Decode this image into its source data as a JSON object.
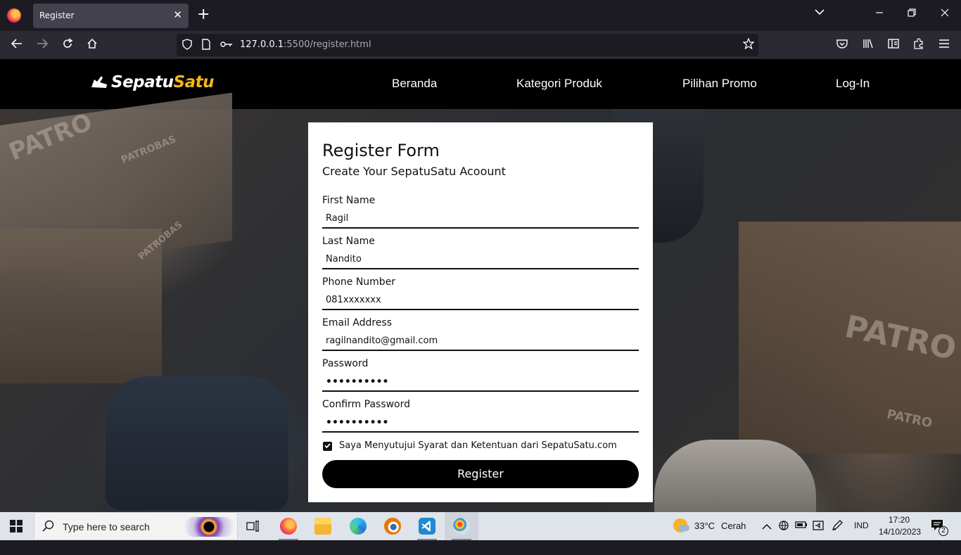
{
  "browser": {
    "tab_title": "Register",
    "tab_close": "✕",
    "new_tab": "+",
    "tab_list": "⌄",
    "url_host": "127.0.0.1",
    "url_path": ":5500/register.html"
  },
  "site": {
    "logo_main": "Sepatu",
    "logo_accent": "Satu",
    "accent_color": "#f7b51f",
    "menu": [
      "Beranda",
      "Kategori Produk",
      "Pilihan Promo",
      "Log-In"
    ],
    "background_text": [
      "PATRO",
      "PATROBAS",
      "PATRO",
      "PATRO",
      "PATROBAS"
    ]
  },
  "form": {
    "title": "Register Form",
    "subtitle": "Create Your SepatuSatu Acoount",
    "fields": [
      {
        "label": "First Name",
        "value": "Ragil"
      },
      {
        "label": "Last Name",
        "value": "Nandito"
      },
      {
        "label": "Phone Number",
        "value": "081xxxxxxx"
      },
      {
        "label": "Email Address",
        "value": "ragilnandito@gmail.com"
      },
      {
        "label": "Password",
        "value": "••••••••••"
      },
      {
        "label": "Confirm Password",
        "value": "••••••••••"
      }
    ],
    "agree_checked": true,
    "agree_label": "Saya Menyutujui Syarat dan Ketentuan dari SepatuSatu.com",
    "submit_label": "Register"
  },
  "taskbar": {
    "search_placeholder": "Type here to search",
    "weather_temp": "33°C",
    "weather_text": "Cerah",
    "language": "IND",
    "time": "17:20",
    "date": "14/10/2023",
    "notification_count": "2"
  }
}
